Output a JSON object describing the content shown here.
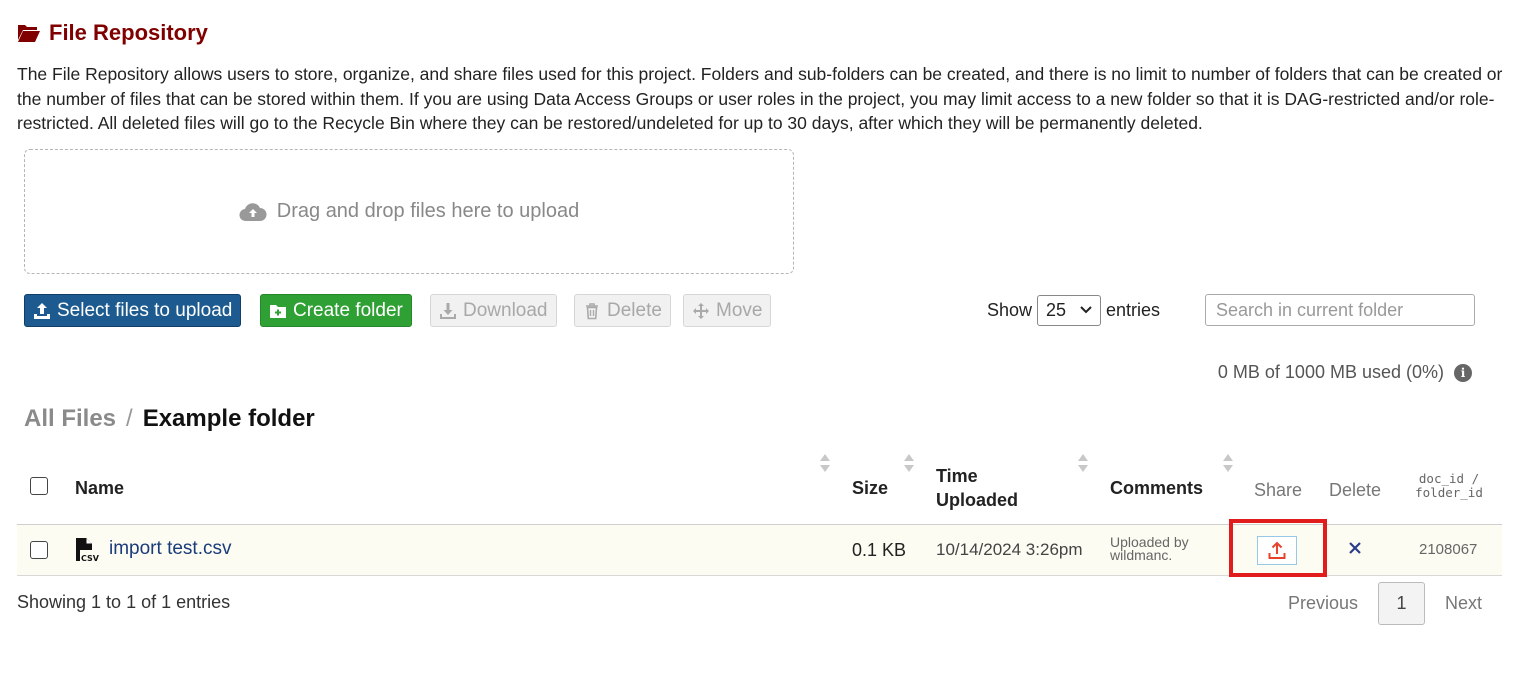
{
  "header": {
    "title": "File Repository",
    "description": "The File Repository allows users to store, organize, and share files used for this project. Folders and sub-folders can be created, and there is no limit to number of folders that can be created or the number of files that can be stored within them. If you are using Data Access Groups or user roles in the project, you may limit access to a new folder so that it is DAG-restricted and/or role-restricted. All deleted files will go to the Recycle Bin where they can be restored/undeleted for up to 30 days, after which they will be permanently deleted."
  },
  "dropzone": {
    "text": "Drag and drop files here to upload"
  },
  "toolbar": {
    "select_files": "Select files to upload",
    "create_folder": "Create folder",
    "download": "Download",
    "delete": "Delete",
    "move": "Move"
  },
  "entries": {
    "show_label": "Show",
    "value": "25",
    "suffix": "entries"
  },
  "search": {
    "placeholder": "Search in current folder"
  },
  "usage": {
    "text": "0 MB of 1000 MB used (0%)"
  },
  "breadcrumb": {
    "root": "All Files",
    "separator": "/",
    "current": "Example folder"
  },
  "table": {
    "columns": {
      "name": "Name",
      "size": "Size",
      "time_line1": "Time",
      "time_line2": "Uploaded",
      "comments": "Comments",
      "share": "Share",
      "delete": "Delete",
      "id_line1": "doc_id /",
      "id_line2": "folder_id"
    },
    "rows": [
      {
        "name": "import test.csv",
        "size": "0.1 KB",
        "time": "10/14/2024 3:26pm",
        "comment_line1": "Uploaded by",
        "comment_line2": "wildmanc.",
        "doc_id": "2108067"
      }
    ]
  },
  "footer": {
    "showing": "Showing 1 to 1 of 1 entries",
    "previous": "Previous",
    "page": "1",
    "next": "Next"
  },
  "colors": {
    "title": "#800000",
    "primary": "#1c5a8f",
    "success": "#2fa034",
    "highlight": "#e01c1c",
    "share_icon": "#e8412c",
    "delete_icon": "#2b3c8a"
  }
}
